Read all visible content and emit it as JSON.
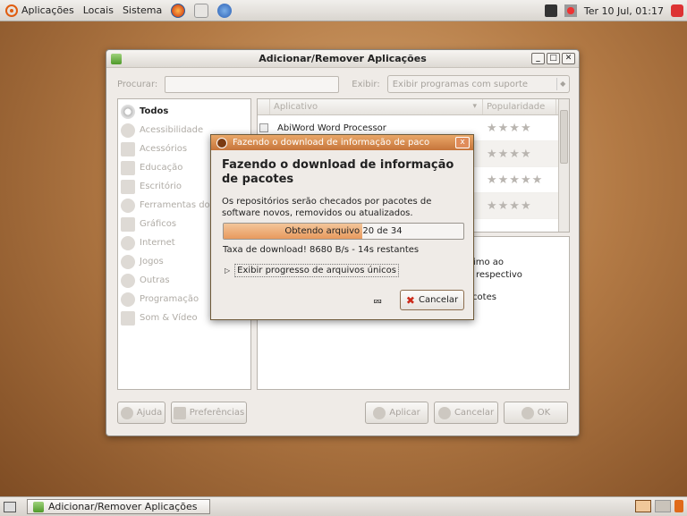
{
  "top_panel": {
    "menus": [
      "Aplicações",
      "Locais",
      "Sistema"
    ],
    "clock": "Ter 10 Jul, 01:17"
  },
  "window": {
    "title": "Adicionar/Remover Aplicações",
    "search_label": "Procurar:",
    "search_value": "",
    "show_label": "Exibir:",
    "show_value": "Exibir programas com suporte",
    "categories": [
      "Todos",
      "Acessibilidade",
      "Acessórios",
      "Educação",
      "Escritório",
      "Ferramentas do S",
      "Gráficos",
      "Internet",
      "Jogos",
      "Outras",
      "Programação",
      "Som & Vídeo"
    ],
    "columns": {
      "app": "Aplicativo",
      "popularity": "Popularidade"
    },
    "apps": [
      {
        "name": "AbiWord Word Processor",
        "stars": "★★★★"
      },
      {
        "name": "",
        "stars": "★★★★"
      },
      {
        "name": "",
        "stars": "★★★★★"
      },
      {
        "name": "",
        "stars": "★★★★"
      }
    ],
    "description_lines": [
      "próximo ao",
      "o do respectivo"
    ],
    "description_line3": "e Pacotes",
    "buttons": {
      "help": "Ajuda",
      "prefs": "Preferências",
      "apply": "Aplicar",
      "cancel": "Cancelar",
      "ok": "OK"
    }
  },
  "dialog": {
    "title": "Fazendo o download de informação de paco",
    "heading": "Fazendo o download de informação de pacotes",
    "body": "Os repositórios serão checados por pacotes de software novos, removidos ou atualizados.",
    "progress_text": "Obtendo arquivo 20 de 34",
    "progress_fraction": 0.58,
    "rate": "Taxa de download! 8680  B/s - 14s restantes",
    "expander": "Exibir progresso de arquivos únicos",
    "cancel": "Cancelar"
  },
  "taskbar": {
    "task": "Adicionar/Remover Aplicações"
  }
}
